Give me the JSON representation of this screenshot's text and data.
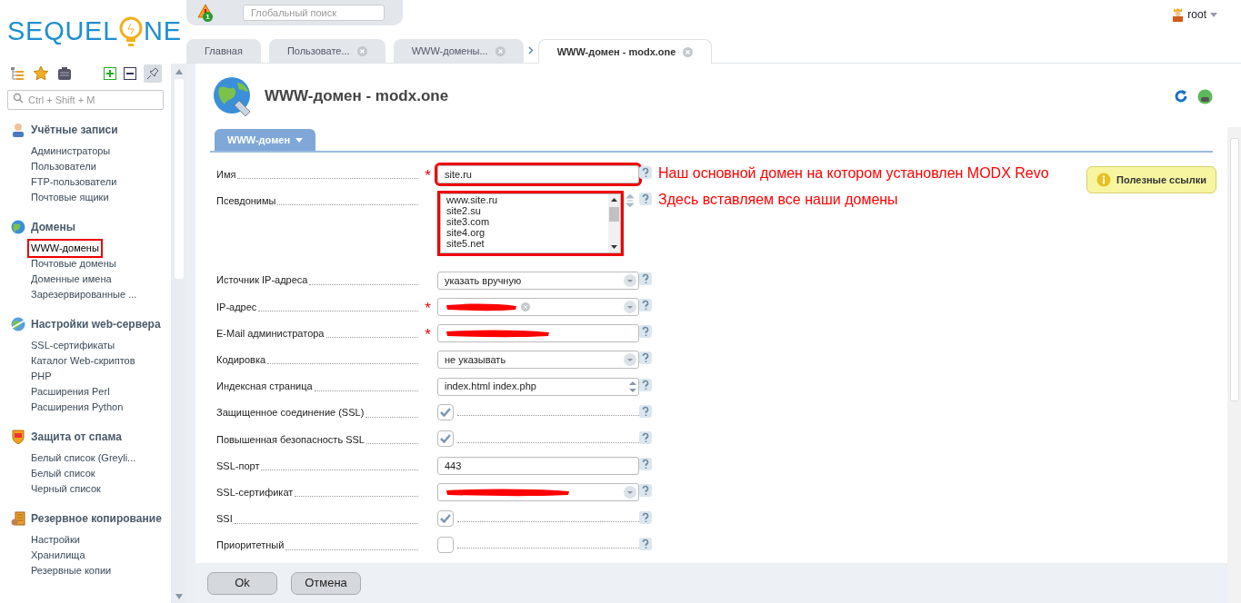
{
  "logo": {
    "left": "SEQUEL",
    "right": "NE"
  },
  "sidebar": {
    "search": {
      "placeholder": "Ctrl + Shift + M"
    },
    "sections": [
      {
        "title": "Учётные записи",
        "items": [
          {
            "label": "Администраторы",
            "highlighted": false
          },
          {
            "label": "Пользователи",
            "highlighted": false
          },
          {
            "label": "FTP-пользователи",
            "highlighted": false
          },
          {
            "label": "Почтовые ящики",
            "highlighted": false
          }
        ]
      },
      {
        "title": "Домены",
        "items": [
          {
            "label": "WWW-домены",
            "highlighted": true
          },
          {
            "label": "Почтовые домены",
            "highlighted": false
          },
          {
            "label": "Доменные имена",
            "highlighted": false
          },
          {
            "label": "Зарезервированные ...",
            "highlighted": false
          }
        ]
      },
      {
        "title": "Настройки web-сервера",
        "items": [
          {
            "label": "SSL-сертификаты",
            "highlighted": false
          },
          {
            "label": "Каталог Web-скриптов",
            "highlighted": false
          },
          {
            "label": "PHP",
            "highlighted": false
          },
          {
            "label": "Расширения Perl",
            "highlighted": false
          },
          {
            "label": "Расширения Python",
            "highlighted": false
          }
        ]
      },
      {
        "title": "Защита от спама",
        "items": [
          {
            "label": "Белый список (Greyli...",
            "highlighted": false
          },
          {
            "label": "Белый список",
            "highlighted": false
          },
          {
            "label": "Черный список",
            "highlighted": false
          }
        ]
      },
      {
        "title": "Резервное копирование",
        "items": [
          {
            "label": "Настройки",
            "highlighted": false
          },
          {
            "label": "Хранилища",
            "highlighted": false
          },
          {
            "label": "Резервные копии",
            "highlighted": false
          }
        ]
      }
    ]
  },
  "topbar": {
    "alert_count": "1",
    "search": {
      "placeholder": "Глобальный поиск"
    },
    "user": "root"
  },
  "tabs": [
    {
      "label": "Главная",
      "closable": false,
      "selected": false
    },
    {
      "label": "Пользовате...",
      "closable": true,
      "selected": false
    },
    {
      "label": "WWW-домены...",
      "closable": true,
      "selected": false
    },
    {
      "label": "WWW-домен - modx.one",
      "closable": true,
      "selected": true
    }
  ],
  "page": {
    "title": "WWW-домен - modx.one",
    "form_tab": "WWW-домен",
    "links_button": "Полезные ссылки"
  },
  "form": [
    {
      "kind": "text",
      "label": "Имя",
      "required_mark": "*",
      "value": "site.ru",
      "highlighted": true,
      "note": "Наш основной домен на котором установлен MODX Revo"
    },
    {
      "kind": "list",
      "label": "Псевдонимы",
      "lines": [
        "www.site.ru",
        "site2.su",
        "site3.com",
        "site4.org",
        "site5.net"
      ],
      "highlighted": true,
      "note": "Здесь вставляем все наши домены"
    },
    {
      "kind": "select",
      "label": "Источник IP-адреса",
      "value": "указать вручную"
    },
    {
      "kind": "tags",
      "label": "IP-адрес",
      "required_mark": "*",
      "redacted": true
    },
    {
      "kind": "text",
      "label": "E-Mail администратора",
      "required_mark": "*",
      "redacted": true
    },
    {
      "kind": "select",
      "label": "Кодировка",
      "value": "не указывать"
    },
    {
      "kind": "spinner",
      "label": "Индексная страница",
      "value": "index.html index.php"
    },
    {
      "kind": "checkbox",
      "label": "Защищенное соединение (SSL)",
      "checked": true
    },
    {
      "kind": "checkbox",
      "label": "Повышенная безопасность SSL",
      "checked": true
    },
    {
      "kind": "text",
      "label": "SSL-порт",
      "value": "443"
    },
    {
      "kind": "select",
      "label": "SSL-сертификат",
      "redacted": true
    },
    {
      "kind": "checkbox",
      "label": "SSI",
      "checked": true
    },
    {
      "kind": "checkbox",
      "label": "Приоритетный",
      "checked": false
    }
  ],
  "buttons": [
    "Ok",
    "Отмена"
  ]
}
